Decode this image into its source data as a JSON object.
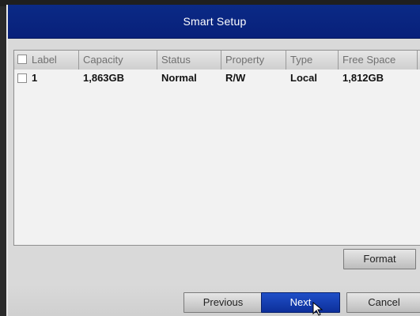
{
  "dialog": {
    "title": "Smart Setup"
  },
  "table": {
    "columns": [
      "Label",
      "Capacity",
      "Status",
      "Property",
      "Type",
      "Free Space"
    ],
    "rows": [
      {
        "label": "1",
        "capacity": "1,863GB",
        "status": "Normal",
        "property": "R/W",
        "type": "Local",
        "free_space": "1,812GB"
      }
    ]
  },
  "buttons": {
    "format": "Format",
    "previous": "Previous",
    "next": "Next",
    "cancel": "Cancel"
  },
  "icons": {
    "checkbox": "checkbox-icon",
    "cursor": "pointer-cursor-icon"
  },
  "colors": {
    "title_bar": "#0b2a86",
    "next_button": "#1f4fc8"
  }
}
